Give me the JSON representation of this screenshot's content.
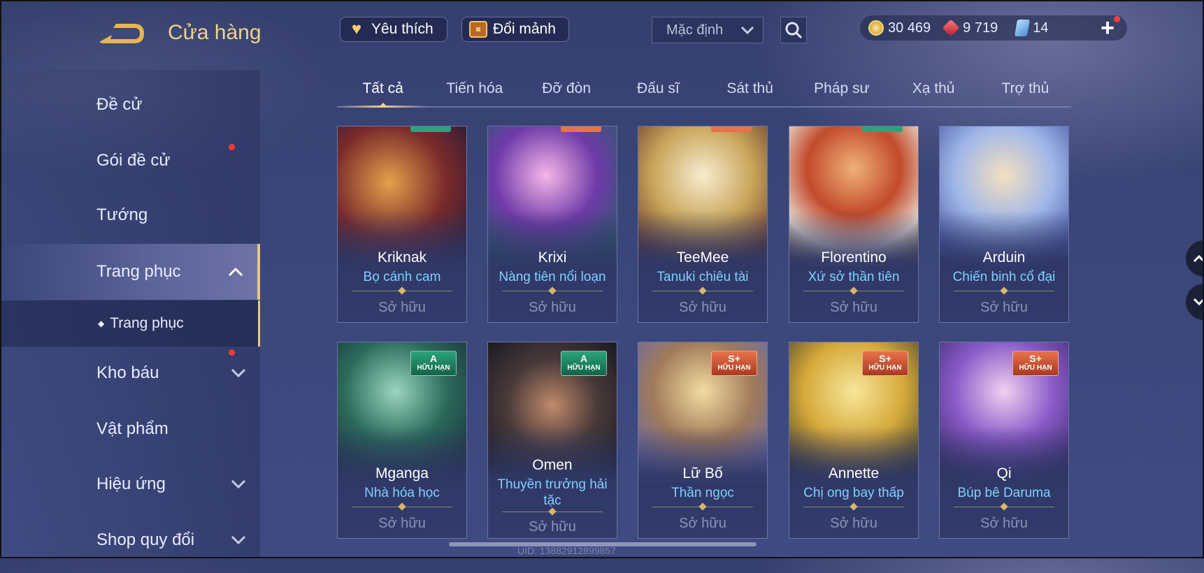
{
  "header": {
    "title": "Cửa hàng",
    "favorite_label": "Yêu thích",
    "exchange_label": "Đổi mảnh",
    "sort_value": "Mặc định",
    "currencies": {
      "gold": "30 469",
      "vouchers": "9 719",
      "tickets": "14"
    },
    "add_label": "+"
  },
  "sidebar": {
    "items": [
      {
        "label": "Đề cử"
      },
      {
        "label": "Gói đề cử"
      },
      {
        "label": "Tướng"
      },
      {
        "label": "Trang phục"
      },
      {
        "label": "Trang phục"
      },
      {
        "label": "Kho báu"
      },
      {
        "label": "Vật phẩm"
      },
      {
        "label": "Hiệu ứng"
      },
      {
        "label": "Shop quy đổi"
      }
    ]
  },
  "tabs": [
    "Tất cả",
    "Tiến hóa",
    "Đỡ đòn",
    "Đấu sĩ",
    "Sát thủ",
    "Pháp sư",
    "Xạ thủ",
    "Trợ thủ"
  ],
  "cards": [
    {
      "hero": "Kriknak",
      "skin": "Bọ cánh cam",
      "status": "Sở hữu"
    },
    {
      "hero": "Krixi",
      "skin": "Nàng tiên nổi loạn",
      "status": "Sở hữu"
    },
    {
      "hero": "TeeMee",
      "skin": "Tanuki chiêu tài",
      "status": "Sở hữu"
    },
    {
      "hero": "Florentino",
      "skin": "Xứ sở thần tiên",
      "status": "Sở hữu"
    },
    {
      "hero": "Arduin",
      "skin": "Chiến binh cổ đại",
      "status": "Sở hữu"
    },
    {
      "hero": "Mganga",
      "skin": "Nhà hóa học",
      "status": "Sở hữu",
      "badge_tier": "A",
      "badge_text": "HỮU HẠN"
    },
    {
      "hero": "Omen",
      "skin": "Thuyền trưởng hải tặc",
      "status": "Sở hữu",
      "badge_tier": "A",
      "badge_text": "HỮU HẠN"
    },
    {
      "hero": "Lữ Bố",
      "skin": "Thần ngọc",
      "status": "Sở hữu",
      "badge_tier": "S+",
      "badge_text": "HỮU HẠN"
    },
    {
      "hero": "Annette",
      "skin": "Chị ong bay thấp",
      "status": "Sở hữu",
      "badge_tier": "S+",
      "badge_text": "HỮU HẠN"
    },
    {
      "hero": "Qi",
      "skin": "Búp bê Daruma",
      "status": "Sở hữu",
      "badge_tier": "S+",
      "badge_text": "HỮU HẠN"
    }
  ],
  "footer": {
    "uid": "UID: 13882912899857"
  },
  "colors": {
    "accent_gold": "#f0d28a",
    "skin_name": "#7fd0ff",
    "badge_a": "#2aa57a",
    "badge_s": "#e8734a"
  }
}
